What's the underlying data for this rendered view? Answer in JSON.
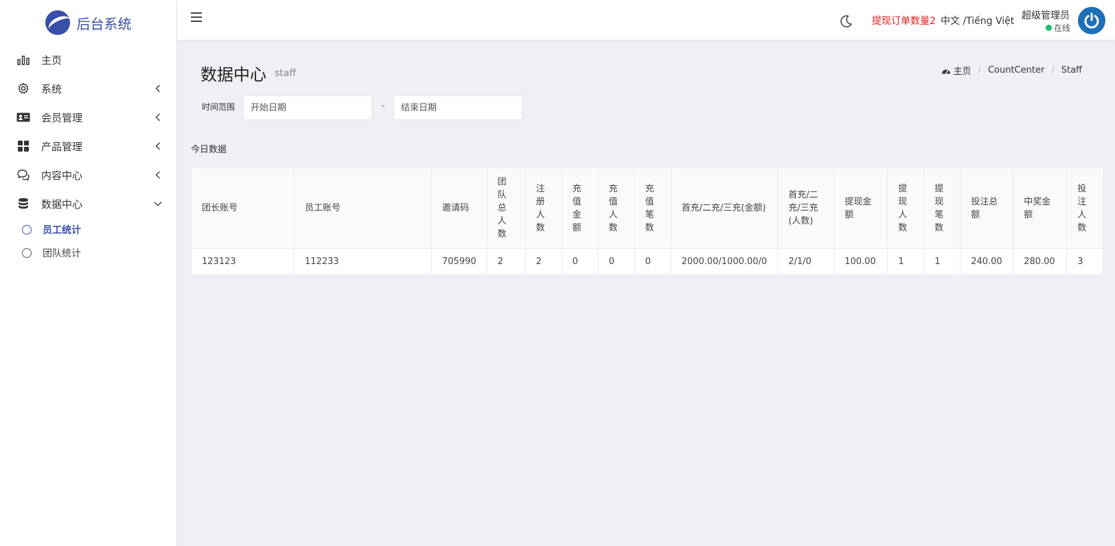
{
  "brand": {
    "name": "后台系统"
  },
  "sidebar": {
    "items": [
      {
        "label": "主页",
        "icon": "bar-chart-icon"
      },
      {
        "label": "系统",
        "icon": "gear-icon"
      },
      {
        "label": "会员管理",
        "icon": "id-card-icon"
      },
      {
        "label": "产品管理",
        "icon": "grid-icon"
      },
      {
        "label": "内容中心",
        "icon": "chat-icon"
      },
      {
        "label": "数据中心",
        "icon": "database-icon"
      }
    ],
    "subitems": [
      {
        "label": "员工统计",
        "active": true
      },
      {
        "label": "团队统计",
        "active": false
      }
    ]
  },
  "header": {
    "withdraw_label": "提现订单数量2",
    "language": "中文 /Tiếng Việt",
    "user_name": "超级管理员",
    "user_status": "在线"
  },
  "page": {
    "title": "数据中心",
    "subtitle": "staff",
    "breadcrumb": [
      "主页",
      "CountCenter",
      "Staff"
    ]
  },
  "filter": {
    "label": "时间范围",
    "start_placeholder": "开始日期",
    "end_placeholder": "结束日期",
    "separator": "-"
  },
  "table": {
    "title": "今日数据",
    "columns": [
      "团长账号",
      "员工账号",
      "邀请码",
      "团队总人数",
      "注册人数",
      "充值金额",
      "充值人数",
      "充值笔数",
      "首充/二充/三充(金额)",
      "首充/二充/三充(人数)",
      "提现金额",
      "提现人数",
      "提现笔数",
      "投注总额",
      "中奖金额",
      "投注人数"
    ],
    "rows": [
      [
        "123123",
        "112233",
        "705990",
        "2",
        "2",
        "0",
        "0",
        "0",
        "2000.00/1000.00/0",
        "2/1/0",
        "100.00",
        "1",
        "1",
        "240.00",
        "280.00",
        "3"
      ]
    ]
  },
  "colors": {
    "accent": "#3a4fa8",
    "alert": "#e02020",
    "online": "#19be6b",
    "avatar": "#1d6fb8"
  }
}
